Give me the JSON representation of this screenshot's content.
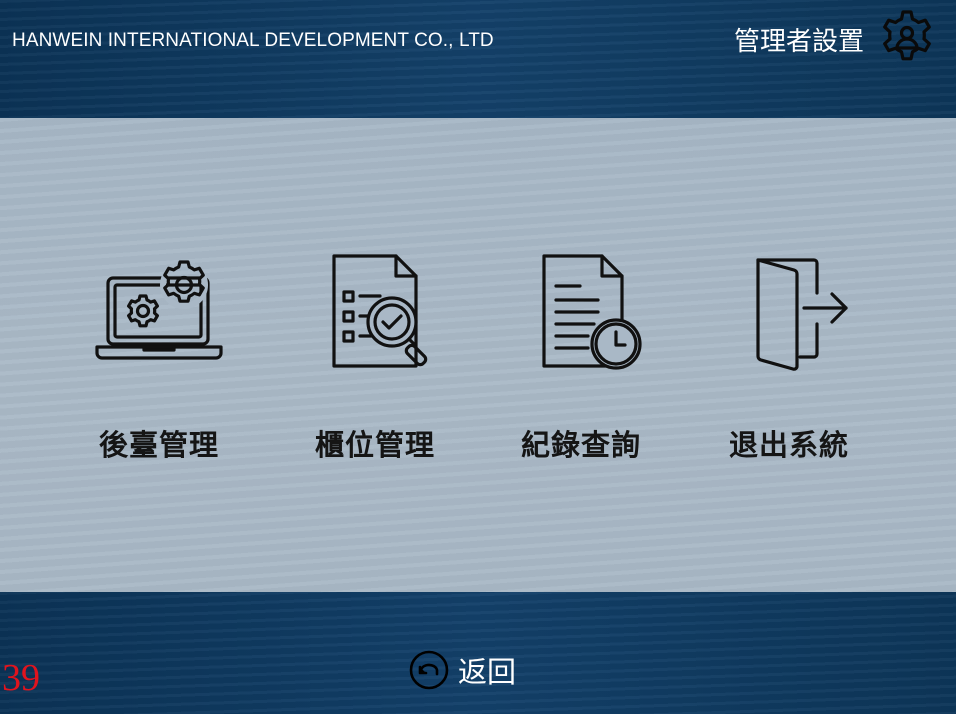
{
  "header": {
    "company": "HANWEIN INTERNATIONAL DEVELOPMENT CO., LTD",
    "admin_label": "管理者設置",
    "admin_icon": "user-gear-icon"
  },
  "menu": {
    "items": [
      {
        "label": "後臺管理",
        "icon": "laptop-gears-icon"
      },
      {
        "label": "櫃位管理",
        "icon": "document-search-icon"
      },
      {
        "label": "紀錄查詢",
        "icon": "document-clock-icon"
      },
      {
        "label": "退出系統",
        "icon": "exit-door-icon"
      }
    ]
  },
  "footer": {
    "back_label": "返回",
    "back_icon": "undo-arrow-icon",
    "counter": "39"
  },
  "colors": {
    "header_bg": "#0c3558",
    "panel_bg": "#a9b8c6",
    "counter": "#e0141e",
    "icon_stroke": "#111111"
  }
}
